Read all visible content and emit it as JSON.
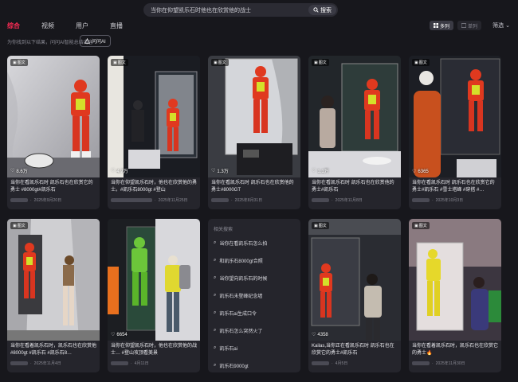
{
  "search": {
    "value": "当你在仰望凯乐石时他也在欣赏他的战士",
    "button": "搜索"
  },
  "tabs": [
    "综合",
    "视频",
    "用户",
    "直播"
  ],
  "view": {
    "multi": "多列",
    "single": "单列"
  },
  "filter": "筛选",
  "subline": "为你找到以下结果，问问AI智能总结内容",
  "ai_button": "问问AI",
  "cards": [
    {
      "tag": "图文",
      "likes": "8.6万",
      "title": "当你在看凯乐石时 凯乐石也在欣赏它的勇士 #8000gt#凯乐石",
      "date": "2025年9月20日"
    },
    {
      "tag": "图文",
      "likes": "4.7万",
      "title": "当你在仰望凯乐石时，他也在欣赏他的勇士。#凯乐石8000gt #登山",
      "date": "2025年11月25日"
    },
    {
      "tag": "图文",
      "likes": "1.3万",
      "title": "当你在看凯乐石时 凯乐石也在欣赏他的勇士#8000GT",
      "date": "2025年8月31日"
    },
    {
      "tag": "图文",
      "likes": "1.1万",
      "title": "当你在看凯乐石时 凯乐石也在欣赏他的勇士#凯乐石",
      "date": "2025年11月8日"
    },
    {
      "tag": "图文",
      "likes": "6365",
      "title": "当你在看凯乐石时 凯乐石也在欣赏它的勇士#凯乐石 #雪士塔峰 #穿搭 #…",
      "date": "2025年10月3日"
    },
    {
      "tag": "图文",
      "likes": "",
      "title": "当你在看着凯乐石时，凯乐石也在欣赏他 #8000gt #凯乐石 #凯乐石8…",
      "date": "2025年11月4日"
    },
    {
      "tag": "",
      "likes": "6654",
      "title": "当你在仰望凯乐石时，他也在欣赏他的战士… #登山攻顶看美景",
      "date": "4月11日"
    },
    {
      "tag": "图文",
      "likes": "4358",
      "title": "Kailas,当你正在看凯乐石时 凯乐石也在欣赏它的勇士#凯乐石",
      "date": "4月5日"
    },
    {
      "tag": "图文",
      "likes": "",
      "title": "当你在看着凯乐石时，凯乐石也在欣赏它的勇士🔥",
      "date": "2025年11月30日"
    }
  ],
  "related": {
    "header": "相关搜索",
    "items": [
      "当你在看凯乐石怎么拍",
      "和凯乐石8000gt合照",
      "当你望向凯乐石的时候",
      "凯乐石未登峰纪念墙",
      "凯乐石ai生成口令",
      "凯乐石怎么突然火了",
      "凯乐石ai",
      "凯乐石9000gt"
    ]
  }
}
